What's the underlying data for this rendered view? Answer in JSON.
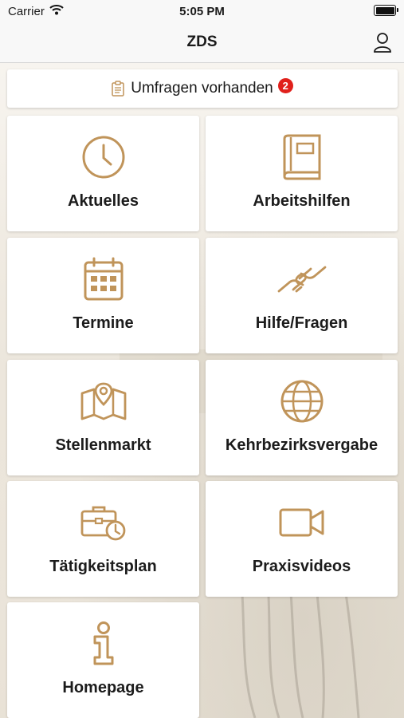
{
  "status_bar": {
    "carrier": "Carrier",
    "time": "5:05 PM"
  },
  "nav": {
    "title": "ZDS",
    "profile_icon": "person-icon"
  },
  "survey": {
    "label": "Umfragen vorhanden",
    "count": "2",
    "icon": "clipboard-icon"
  },
  "tiles": [
    {
      "label": "Aktuelles",
      "icon": "clock-icon"
    },
    {
      "label": "Arbeitshilfen",
      "icon": "book-icon"
    },
    {
      "label": "Termine",
      "icon": "calendar-icon"
    },
    {
      "label": "Hilfe/Fragen",
      "icon": "handshake-icon"
    },
    {
      "label": "Stellenmarkt",
      "icon": "map-pin-icon"
    },
    {
      "label": "Kehrbezirksvergabe",
      "icon": "globe-icon"
    },
    {
      "label": "Tätigkeitsplan",
      "icon": "briefcase-clock-icon"
    },
    {
      "label": "Praxisvideos",
      "icon": "video-camera-icon"
    },
    {
      "label": "Homepage",
      "icon": "info-icon"
    }
  ],
  "colors": {
    "accent": "#c0945a",
    "badge": "#e0201b",
    "tile": "#ffffff"
  }
}
